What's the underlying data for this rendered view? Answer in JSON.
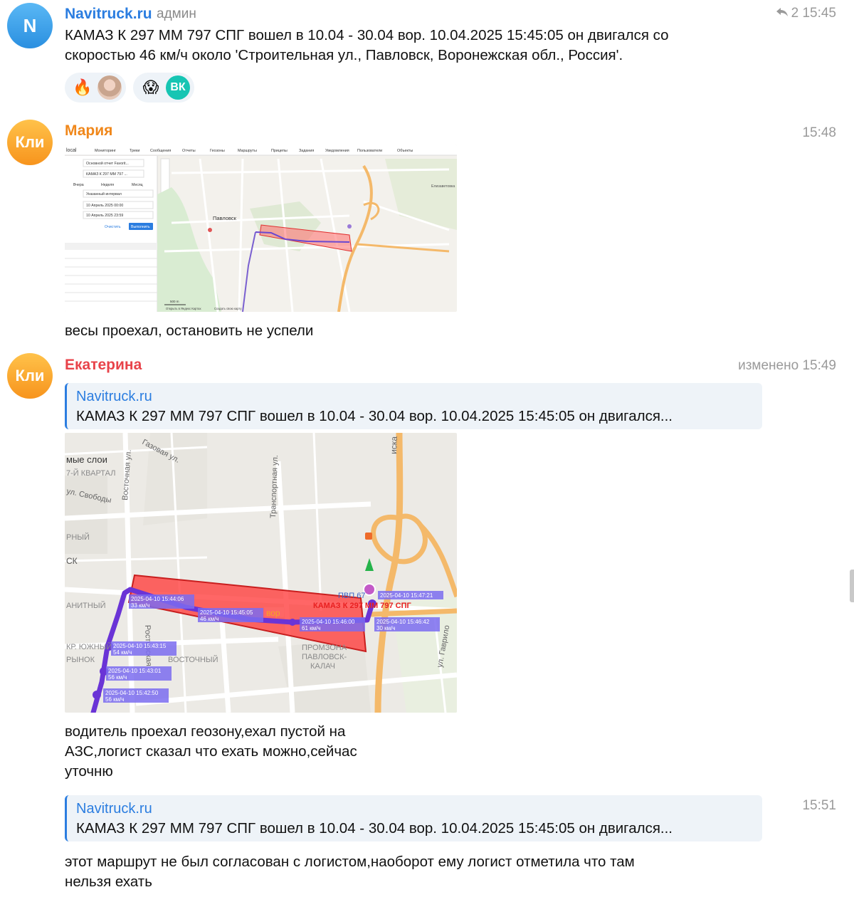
{
  "messages": [
    {
      "avatar": "N",
      "author": "Navitruck.ru",
      "role": "админ",
      "forwards": "2",
      "time": "15:45",
      "text_line1": "КАМАЗ К 297 ММ 797 СПГ вошел в 10.04 - 30.04 вор. 10.04.2025 15:45:05 он двигался со",
      "text_line2": "скоростью 46 км/ч около 'Строительная ул., Павловск, Воронежская обл., Россия'.",
      "reactions": [
        {
          "emoji": "🔥",
          "avatar": "photo"
        },
        {
          "emoji": "😱",
          "avatar": "ВК"
        }
      ]
    },
    {
      "avatar": "Кли",
      "author": "Мария",
      "time": "15:48",
      "text": "весы проехал, остановить не успели"
    },
    {
      "avatar": "Кли",
      "author": "Екатерина",
      "time": "изменено 15:49",
      "quote_author": "Navitruck.ru",
      "quote_text": "КАМАЗ К 297 ММ 797 СПГ вошел в 10.04 - 30.04 вор. 10.04.2025 15:45:05 он двигался...",
      "text_line1": "водитель проехал геозону,ехал пустой на",
      "text_line2": "АЗС,логист сказал что ехать можно,сейчас",
      "text_line3": "уточню"
    },
    {
      "time": "15:51",
      "quote_author": "Navitruck.ru",
      "quote_text": "КАМАЗ К 297 ММ 797 СПГ вошел в 10.04 - 30.04 вор. 10.04.2025 15:45:05 он двигался...",
      "text_line1": "этот маршрут не был согласован с логистом,наоборот ему логист отметила что там",
      "text_line2": "нельзя ехать"
    }
  ],
  "screenshot1": {
    "logo": "local",
    "menu": [
      "Мониторинг",
      "Треки",
      "Сообщения",
      "Отчеты",
      "Геозоны",
      "Маршруты",
      "Прицепы",
      "Задания",
      "Уведомления",
      "Пользователи",
      "Объекты"
    ],
    "report": "Основной отчет Favorit...",
    "unit": "КАМАЗ К 297 ММ 797 ...",
    "periods": [
      "Вчера",
      "Неделя",
      "Месяц"
    ],
    "interval": "Указанный интервал",
    "from": "10 Апрель 2025 00:00",
    "to": "10 Апрель 2025 23:59",
    "clear": "Очистить",
    "run": "Выполнить",
    "city": "Павловск",
    "east": "Елизаветовка",
    "scale": "500 m",
    "attribution": "Открыть в Яндекс Картах",
    "create": "Создать свою карту"
  },
  "screenshot2": {
    "layers": "мые слои",
    "district": "7-Й КВАРТАЛ",
    "streets": [
      "Газовая ул.",
      "Восточная ул.",
      "Транспортная ул.",
      "ул. Свободы",
      "Ростовская",
      "ул. Гаврило"
    ],
    "areas": [
      "РНЫЙ",
      "СК",
      "АНИТНЫЙ",
      "КР. ЮЖНЫЙ",
      "РЫНОК",
      "ВОСТОЧНЫЙ",
      "ПРОМЗОНА",
      "ПАВЛОВСК-",
      "КАЛАЧ"
    ],
    "road": "иска",
    "pvp": "ПВП 67",
    "vehicle": "КАМАЗ К 297 ММ 797 СПГ",
    "geozone_label": "вор",
    "points": [
      {
        "time": "2025-04-10 15:44:06",
        "speed": "33 км/ч"
      },
      {
        "time": "2025-04-10 15:45:05",
        "speed": "46 км/ч"
      },
      {
        "time": "2025-04-10 15:46:00",
        "speed": "61 км/ч"
      },
      {
        "time": "2025-04-10 15:46:42",
        "speed": "30 км/ч"
      },
      {
        "time": "2025-04-10 15:47:21",
        "speed": ""
      },
      {
        "time": "2025-04-10 15:43:15",
        "speed": "54 км/ч"
      },
      {
        "time": "2025-04-10 15:43:01",
        "speed": "56 км/ч"
      },
      {
        "time": "2025-04-10 15:42:50",
        "speed": "56 км/ч"
      }
    ]
  }
}
